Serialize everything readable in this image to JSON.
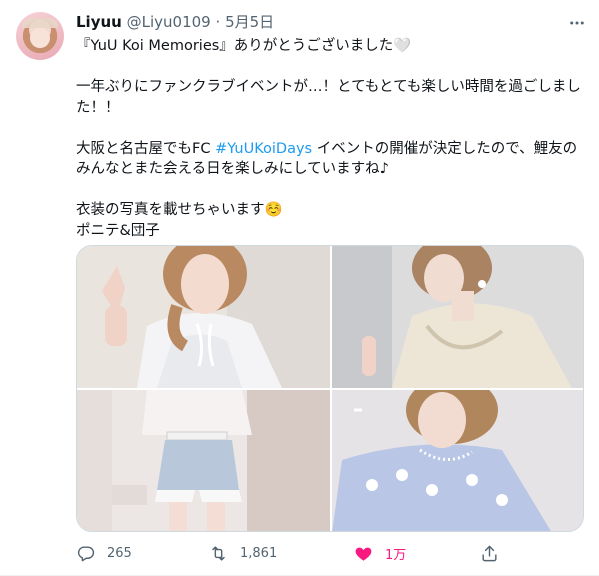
{
  "author": {
    "name": "Liyuu",
    "handle": "@Liyu0109",
    "separator": "·",
    "date": "5月5日"
  },
  "tweet": {
    "line1_text": "『YuU Koi Memories』ありがとうございました",
    "line1_emoji": "🤍",
    "line2": "一年ぶりにファンクラブイベントが…！とてもとても楽しい時間を過ごしました！！",
    "line3_before": "大阪と名古屋でもFC ",
    "line3_hashtag": "#YuUKoiDays",
    "line3_after": " イベントの開催が決定したので、鯉友のみんなとまた会える日を楽しみにしていますね♪",
    "line4_text": "衣装の写真を載せちゃいます",
    "line4_emoji": "☺️",
    "line5": "ポニテ&団子"
  },
  "actions": {
    "reply_count": "265",
    "retweet_count": "1,861",
    "like_count": "1万"
  },
  "icons": {
    "more": "more-horizontal-icon",
    "reply": "reply-icon",
    "retweet": "retweet-icon",
    "like": "heart-filled-icon",
    "share": "share-icon"
  },
  "colors": {
    "like": "#f91880",
    "hashtag": "#1d9bf0",
    "secondary_text": "#536471"
  }
}
